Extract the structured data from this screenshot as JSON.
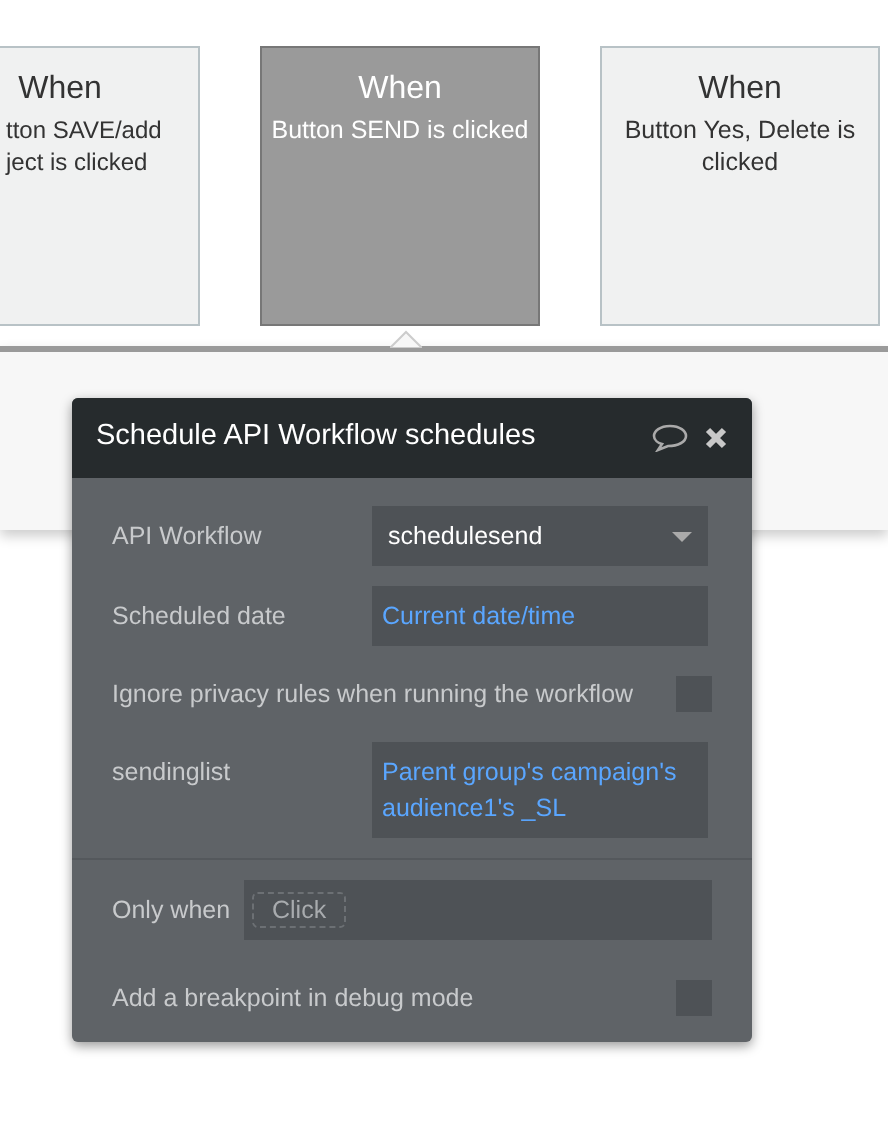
{
  "cards": [
    {
      "title": "When",
      "lines": [
        "tton SAVE/add",
        "ject is clicked"
      ],
      "selected": false,
      "cut": true
    },
    {
      "title": "When",
      "lines": [
        "Button SEND is clicked"
      ],
      "selected": true,
      "cut": false
    },
    {
      "title": "When",
      "lines": [
        "Button Yes, Delete is",
        "clicked"
      ],
      "selected": false,
      "cut": false
    }
  ],
  "dialog": {
    "title": "Schedule API Workflow schedules",
    "rows": [
      {
        "kind": "dropdown",
        "label": "API Workflow",
        "value": "schedulesend"
      },
      {
        "kind": "expression",
        "label": "Scheduled date",
        "value": "Current date/time"
      },
      {
        "kind": "checkbox",
        "label": "Ignore privacy rules when running the workflow",
        "checked": false
      },
      {
        "kind": "expression",
        "label": "sendinglist",
        "value": "Parent group's campaign's audience1's _SL"
      }
    ],
    "only_when": {
      "label": "Only when",
      "placeholder": "Click"
    },
    "breakpoint": {
      "label": "Add a breakpoint in debug mode",
      "checked": false
    }
  }
}
